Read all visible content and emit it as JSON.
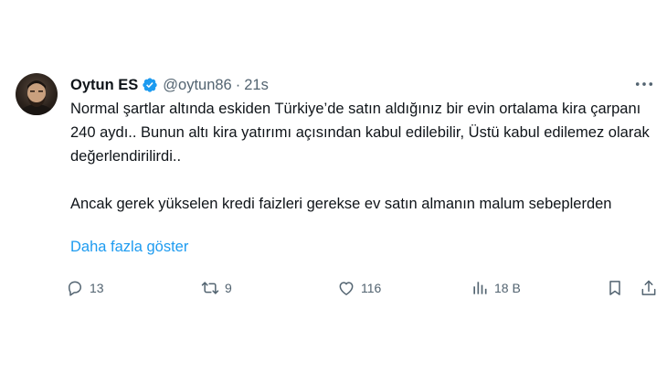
{
  "tweet": {
    "author_name": "Oytun ES",
    "handle": "@oytun86",
    "separator": "·",
    "time": "21s",
    "paragraph1": "Normal şartlar altında eskiden Türkiye’de satın aldığınız bir evin ortalama kira çarpanı 240 aydı.. Bunun altı kira yatırımı açısından kabul edilebilir, Üstü kabul edilemez olarak değerlendirilirdi..",
    "paragraph2": "Ancak gerek yükselen kredi faizleri gerekse ev satın almanın malum sebeplerden",
    "show_more": "Daha fazla göster"
  },
  "actions": {
    "replies": "13",
    "retweets": "9",
    "likes": "116",
    "views": "18 B"
  },
  "icons": {
    "verified": "verified-badge-icon",
    "more": "more-dots-icon",
    "reply": "reply-icon",
    "retweet": "retweet-icon",
    "like": "heart-icon",
    "views": "views-chart-icon",
    "bookmark": "bookmark-icon",
    "share": "share-icon"
  },
  "colors": {
    "text": "#0f1419",
    "secondary": "#536471",
    "link": "#1d9bf0",
    "verified": "#1d9bf0"
  }
}
